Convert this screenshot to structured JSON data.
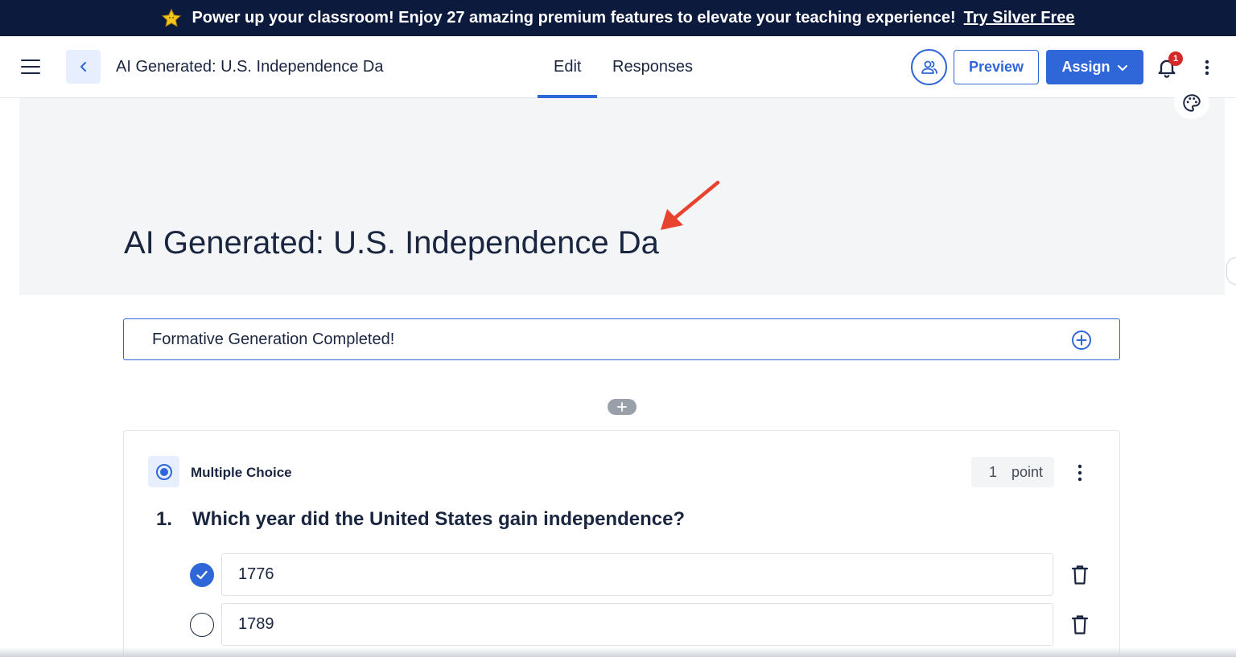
{
  "promo": {
    "text": "Power up your classroom! Enjoy 27 amazing premium features to elevate your teaching experience!",
    "link": "Try Silver Free",
    "star_icon": "star-icon"
  },
  "nav": {
    "doc_title": "AI Generated: U.S. Independence Da",
    "tabs": [
      {
        "label": "Edit",
        "active": true
      },
      {
        "label": "Responses",
        "active": false
      }
    ],
    "preview_label": "Preview",
    "assign_label": "Assign",
    "notification_count": "1"
  },
  "header": {
    "title": "AI Generated: U.S. Independence Da"
  },
  "generation_bar": {
    "text": "Formative Generation Completed!"
  },
  "question": {
    "type_label": "Multiple Choice",
    "points_value": "1",
    "points_label": "point",
    "number": "1.",
    "text": "Which year did the United States gain independence?",
    "choices": [
      {
        "value": "1776",
        "correct": true
      },
      {
        "value": "1789",
        "correct": false
      }
    ]
  },
  "colors": {
    "brand_blue": "#2f66d8",
    "banner_navy": "#0c1b3d",
    "annotation_arrow": "#e8432e",
    "badge_red": "#d62828"
  }
}
